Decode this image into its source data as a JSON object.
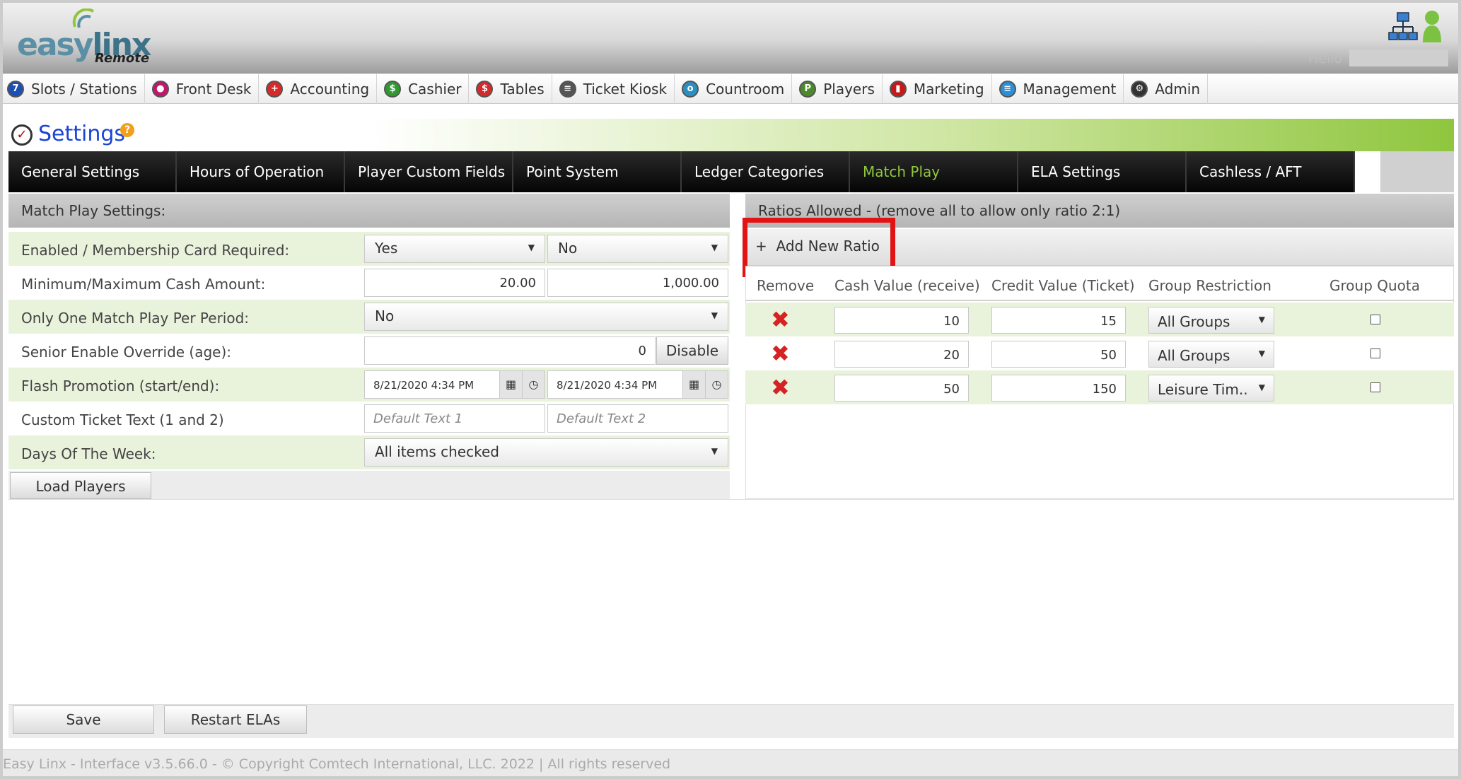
{
  "header": {
    "logo_text_a": "easy",
    "logo_text_b": "linx",
    "logo_sub": "Remote",
    "hello": "Hello"
  },
  "nav": {
    "items": [
      {
        "label": "Slots / Stations",
        "icon": "slots-icon",
        "color": "#1a4fb3"
      },
      {
        "label": "Front Desk",
        "icon": "front-desk-icon",
        "color": "#c0186a"
      },
      {
        "label": "Accounting",
        "icon": "accounting-icon",
        "color": "#d42a2a"
      },
      {
        "label": "Cashier",
        "icon": "cashier-icon",
        "color": "#2f9a2f"
      },
      {
        "label": "Tables",
        "icon": "tables-icon",
        "color": "#d42a2a"
      },
      {
        "label": "Ticket Kiosk",
        "icon": "ticket-kiosk-icon",
        "color": "#555555"
      },
      {
        "label": "Countroom",
        "icon": "countroom-icon",
        "color": "#2b8fbf"
      },
      {
        "label": "Players",
        "icon": "players-icon",
        "color": "#4a8a2a"
      },
      {
        "label": "Marketing",
        "icon": "marketing-icon",
        "color": "#c41a1a"
      },
      {
        "label": "Management",
        "icon": "management-icon",
        "color": "#2a8fd6"
      },
      {
        "label": "Admin",
        "icon": "admin-icon",
        "color": "#333333"
      }
    ]
  },
  "page": {
    "title": "Settings",
    "help": "?"
  },
  "tabs": [
    {
      "label": "General Settings",
      "active": false
    },
    {
      "label": "Hours of Operation",
      "active": false
    },
    {
      "label": "Player Custom Fields",
      "active": false
    },
    {
      "label": "Point System",
      "active": false
    },
    {
      "label": "Ledger Categories",
      "active": false
    },
    {
      "label": "Match Play",
      "active": true
    },
    {
      "label": "ELA Settings",
      "active": false
    },
    {
      "label": "Cashless / AFT",
      "active": false
    }
  ],
  "left": {
    "header": "Match Play Settings:",
    "rows": {
      "enabled": {
        "label": "Enabled / Membership Card Required:",
        "value1": "Yes",
        "value2": "No"
      },
      "cash": {
        "label": "Minimum/Maximum Cash Amount:",
        "min": "20.00",
        "max": "1,000.00"
      },
      "one_per_period": {
        "label": "Only One Match Play Per Period:",
        "value": "No"
      },
      "senior": {
        "label": "Senior Enable Override (age):",
        "value": "0",
        "button": "Disable"
      },
      "flash": {
        "label": "Flash Promotion (start/end):",
        "start": "8/21/2020 4:34 PM",
        "end": "8/21/2020 4:34 PM"
      },
      "ticket_text": {
        "label": "Custom Ticket Text (1 and 2)",
        "placeholder1": "Default Text 1",
        "placeholder2": "Default Text 2"
      },
      "days": {
        "label": "Days Of The Week:",
        "value": "All items checked"
      }
    },
    "load_players": "Load Players"
  },
  "right": {
    "header": "Ratios Allowed - (remove all to allow only ratio 2:1)",
    "add_ratio": "Add New Ratio",
    "columns": [
      "Remove",
      "Cash Value (receive)",
      "Credit Value (Ticket)",
      "Group Restriction",
      "Group Quota"
    ],
    "ratios": [
      {
        "cash": "10",
        "credit": "15",
        "group": "All Groups"
      },
      {
        "cash": "20",
        "credit": "50",
        "group": "All Groups"
      },
      {
        "cash": "50",
        "credit": "150",
        "group": "Leisure Tim.."
      }
    ]
  },
  "actions": {
    "save": "Save",
    "restart": "Restart ELAs"
  },
  "footer": {
    "text": "Easy Linx - Interface v3.5.66.0 - © Copyright Comtech International, LLC. 2022 | All rights reserved"
  },
  "colors": {
    "accent_green": "#8fc63e",
    "title_blue": "#1a44d4",
    "highlight_red": "#e21313"
  }
}
